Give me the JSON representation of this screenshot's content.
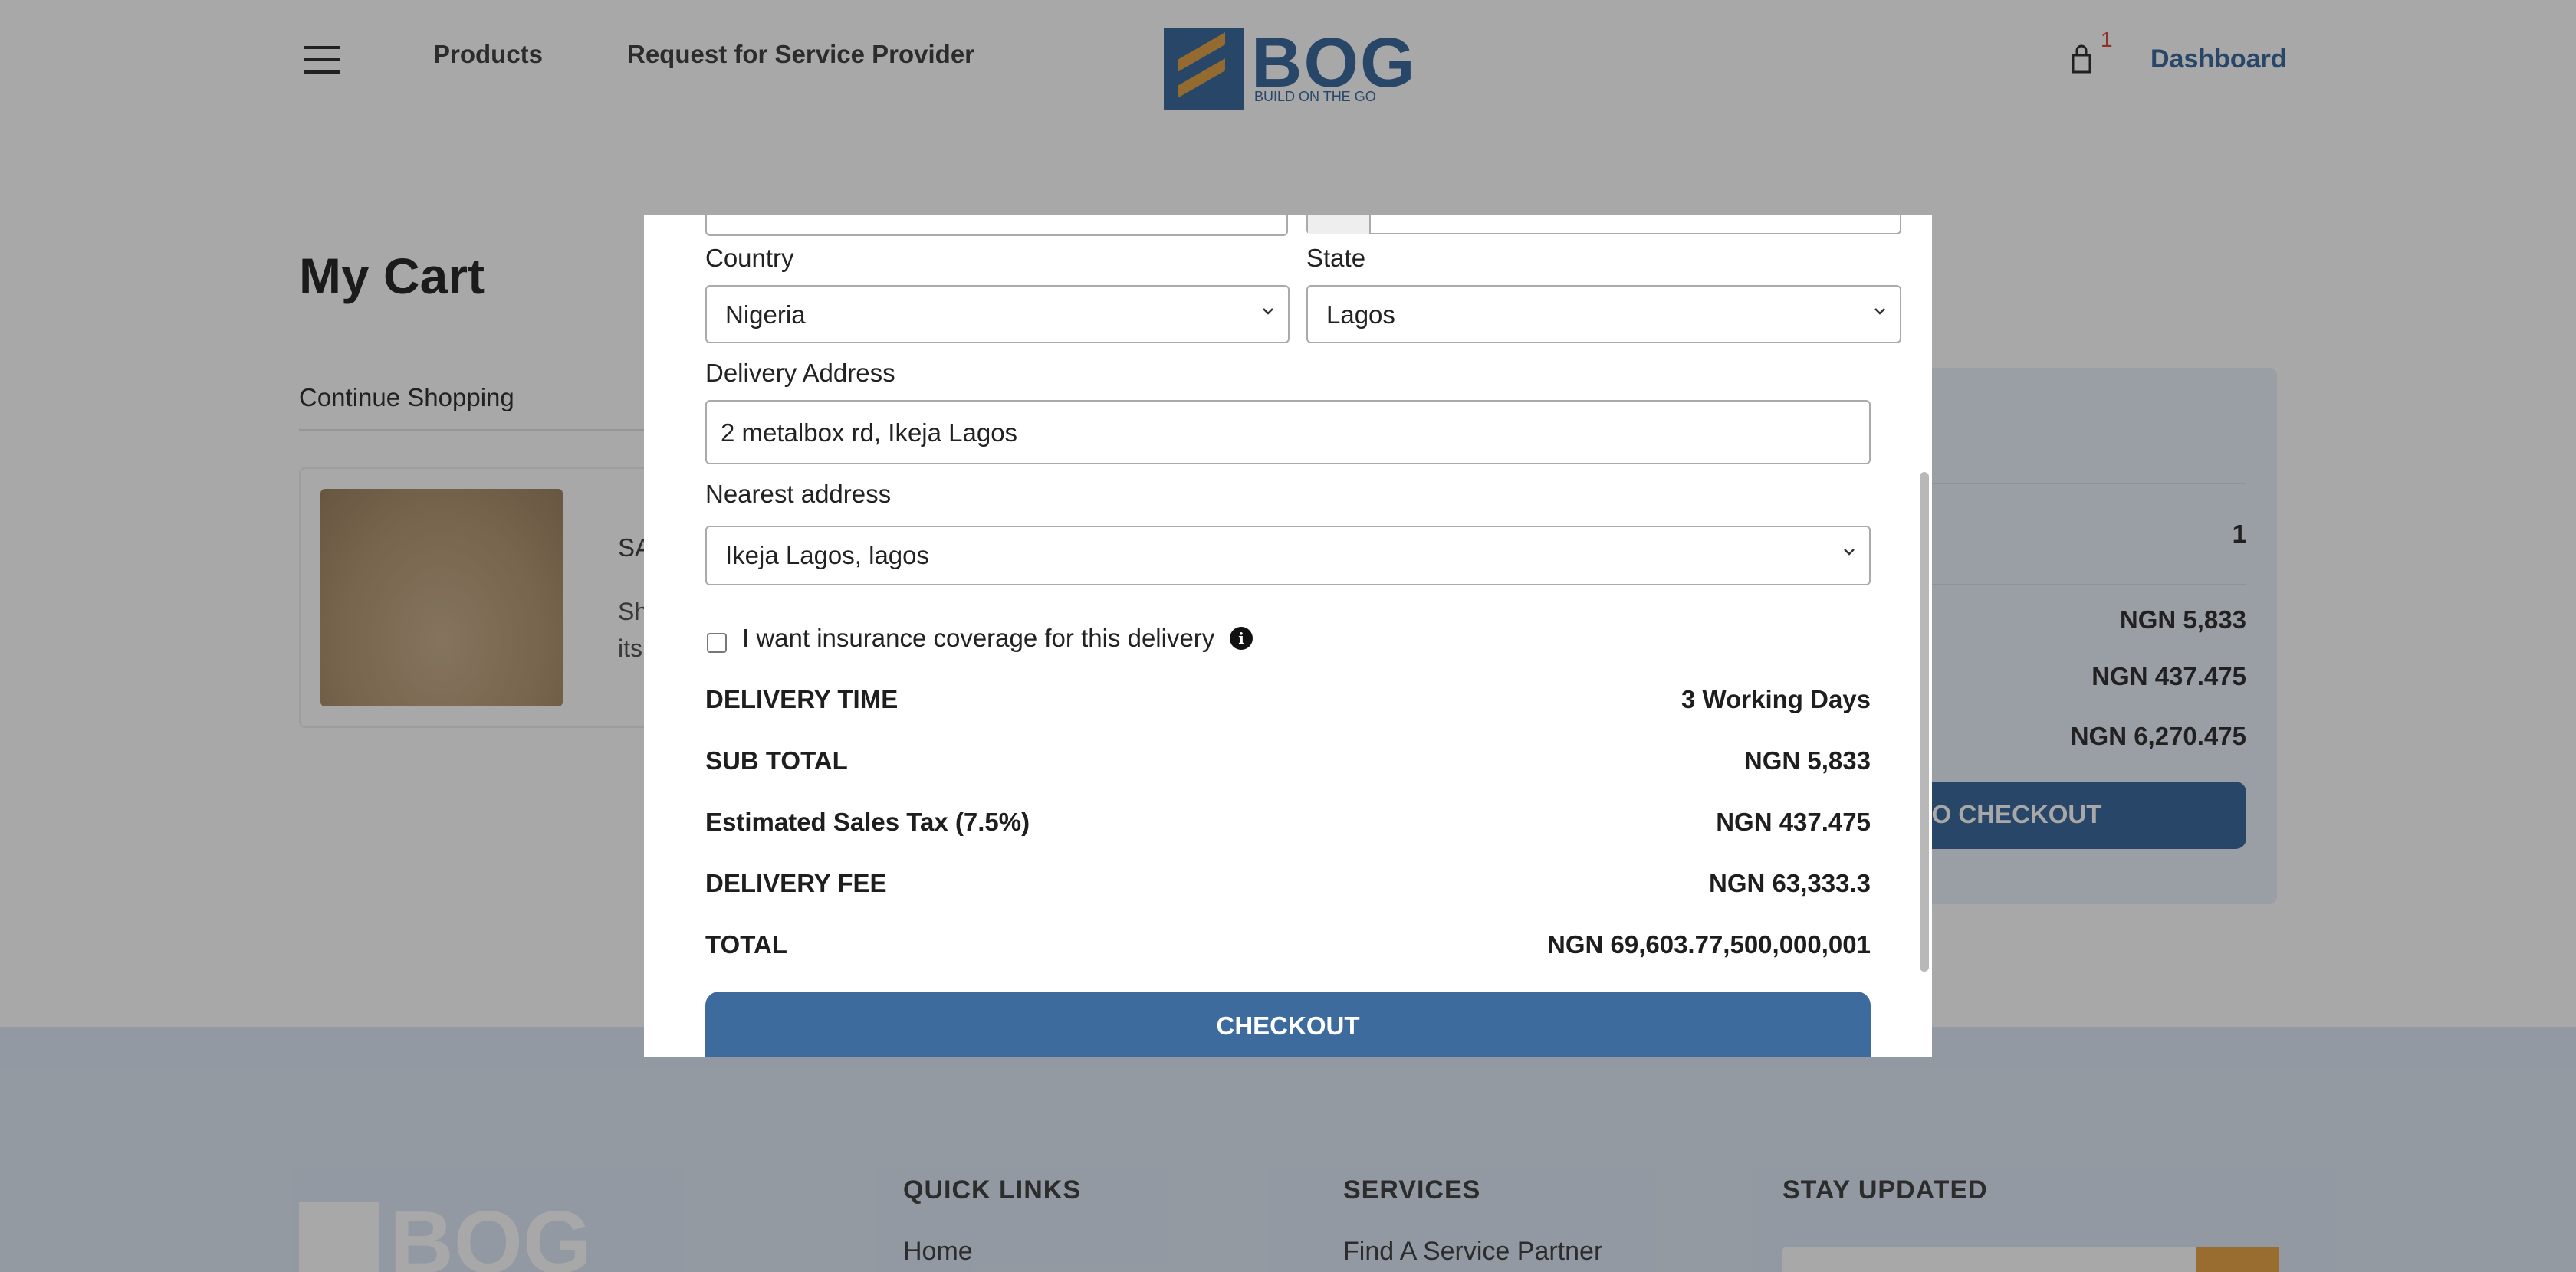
{
  "header": {
    "nav": {
      "products": "Products",
      "request": "Request for Service Provider"
    },
    "logo_text": "BOG",
    "logo_tagline": "BUILD ON THE GO",
    "cart_count": "1",
    "dashboard": "Dashboard"
  },
  "cart": {
    "title": "My Cart",
    "continue": "Continue Shopping",
    "item": {
      "name": "SA",
      "desc_line1": "Sh",
      "desc_line2": "its"
    },
    "summary": {
      "qty": "1",
      "subtotal": "NGN 5,833",
      "tax_label_fragment": "%)",
      "tax": "NGN 437.475",
      "total": "NGN 6,270.475",
      "button": "TO CHECKOUT"
    }
  },
  "footer": {
    "quick_links": "QUICK LINKS",
    "services": "SERVICES",
    "stay_updated": "STAY UPDATED",
    "home": "Home",
    "find_partner": "Find A Service Partner",
    "logo_text": "BOG"
  },
  "modal": {
    "country_label": "Country",
    "country_value": "Nigeria",
    "state_label": "State",
    "state_value": "Lagos",
    "address_label": "Delivery Address",
    "address_value": "2 metalbox rd, Ikeja Lagos",
    "nearest_label": "Nearest address",
    "nearest_value": "Ikeja Lagos, lagos",
    "insurance_label": "I want insurance coverage for this delivery",
    "rows": [
      {
        "label": "DELIVERY TIME",
        "value": "3 Working Days"
      },
      {
        "label": "SUB TOTAL",
        "value": "NGN 5,833"
      },
      {
        "label": "Estimated Sales Tax (7.5%)",
        "value": "NGN 437.475"
      },
      {
        "label": "DELIVERY FEE",
        "value": "NGN 63,333.3"
      },
      {
        "label": "TOTAL",
        "value": "NGN 69,603.77,500,000,001"
      }
    ],
    "checkout": "CHECKOUT"
  }
}
